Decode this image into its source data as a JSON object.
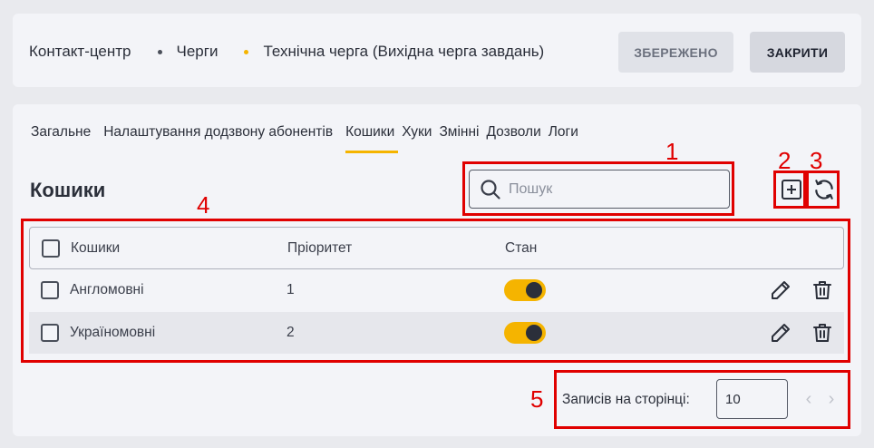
{
  "breadcrumbs": [
    {
      "label": "Контакт-центр"
    },
    {
      "label": "Черги",
      "dot_color": "#4a4f5a"
    },
    {
      "label": "Технічна черга (Вихідна черга завдань)",
      "dot_color": "#f5b400"
    }
  ],
  "header": {
    "saved_label": "ЗБЕРЕЖЕНО",
    "close_label": "ЗАКРИТИ"
  },
  "tabs": [
    {
      "label": "Загальне",
      "active": false
    },
    {
      "label": "Налаштування додзвону абонентів",
      "active": false
    },
    {
      "label": "Кошики",
      "active": true
    },
    {
      "label": "Хуки",
      "active": false
    },
    {
      "label": "Змінні",
      "active": false
    },
    {
      "label": "Дозволи",
      "active": false
    },
    {
      "label": "Логи",
      "active": false
    }
  ],
  "section_title": "Кошики",
  "search": {
    "placeholder": "Пошук",
    "value": ""
  },
  "toolbar_icons": {
    "add": "plus-square-icon",
    "refresh": "refresh-icon"
  },
  "table": {
    "columns": [
      "Кошики",
      "Пріоритет",
      "Стан"
    ],
    "rows": [
      {
        "name": "Англомовні",
        "priority": "1",
        "state_on": true
      },
      {
        "name": "Україномовні",
        "priority": "2",
        "state_on": true
      }
    ]
  },
  "pagination": {
    "label": "Записів на сторінці:",
    "value": "10"
  },
  "annotations": [
    "1",
    "2",
    "3",
    "4",
    "5"
  ],
  "colors": {
    "accent": "#f5b400",
    "annotation": "#e00000",
    "panel_bg": "#f3f4f8",
    "page_bg": "#e9eaee"
  }
}
